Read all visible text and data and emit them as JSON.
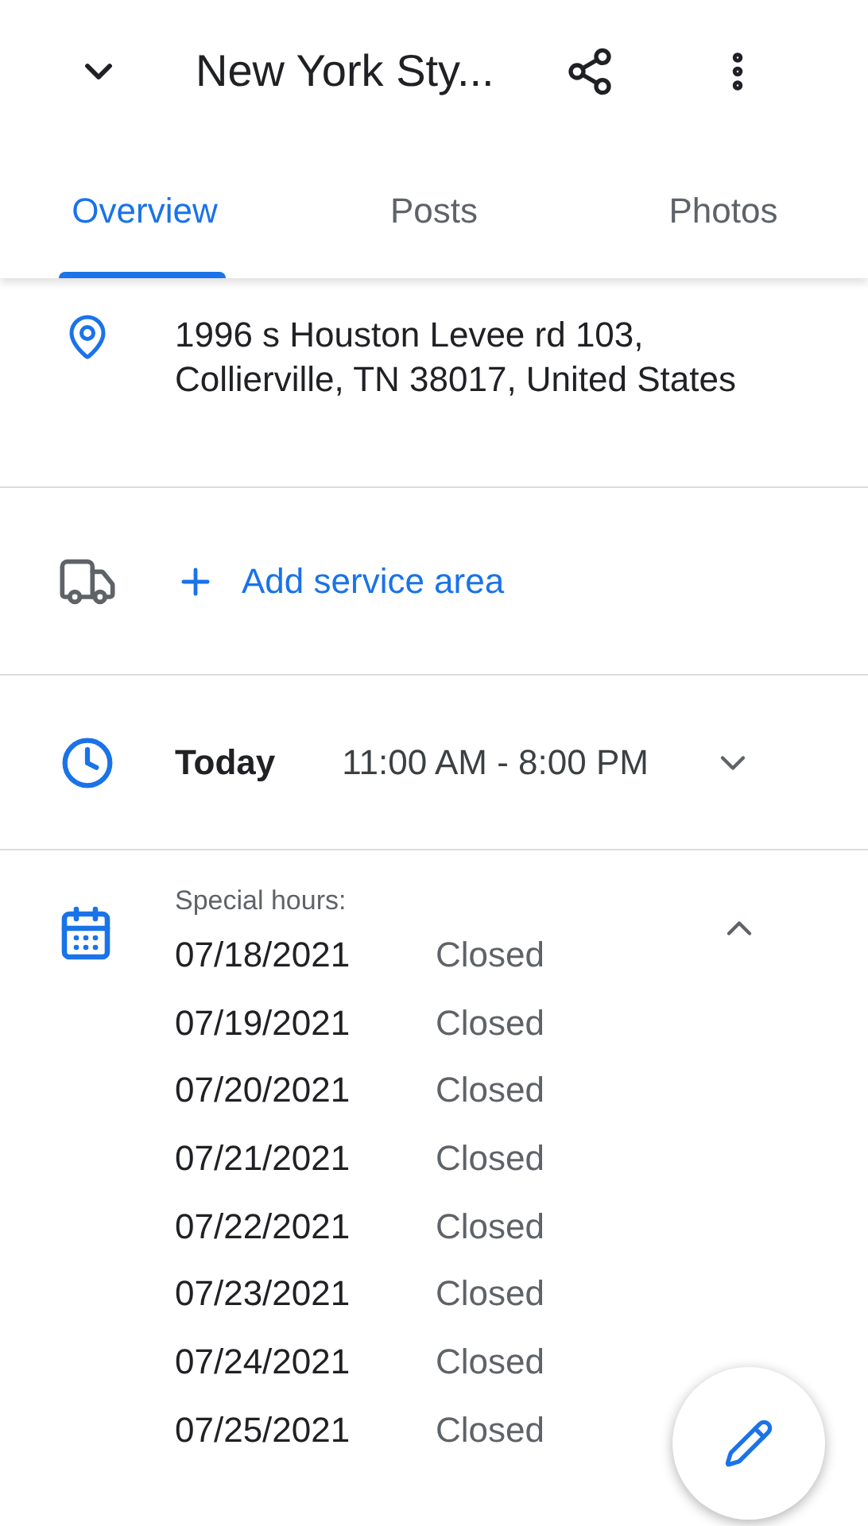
{
  "header": {
    "title": "New York Sty..."
  },
  "tabs": [
    {
      "label": "Overview",
      "selected": true
    },
    {
      "label": "Posts",
      "selected": false
    },
    {
      "label": "Photos",
      "selected": false
    }
  ],
  "address": "1996 s Houston Levee rd 103, Collierville, TN 38017, United States",
  "service_area": {
    "label": "Add service area"
  },
  "hours": {
    "day": "Today",
    "time": "11:00 AM - 8:00 PM",
    "expanded": false
  },
  "special_hours": {
    "label": "Special hours:",
    "expanded": true,
    "entries": [
      {
        "date": "07/18/2021",
        "status": "Closed"
      },
      {
        "date": "07/19/2021",
        "status": "Closed"
      },
      {
        "date": "07/20/2021",
        "status": "Closed"
      },
      {
        "date": "07/21/2021",
        "status": "Closed"
      },
      {
        "date": "07/22/2021",
        "status": "Closed"
      },
      {
        "date": "07/23/2021",
        "status": "Closed"
      },
      {
        "date": "07/24/2021",
        "status": "Closed"
      },
      {
        "date": "07/25/2021",
        "status": "Closed"
      }
    ]
  }
}
